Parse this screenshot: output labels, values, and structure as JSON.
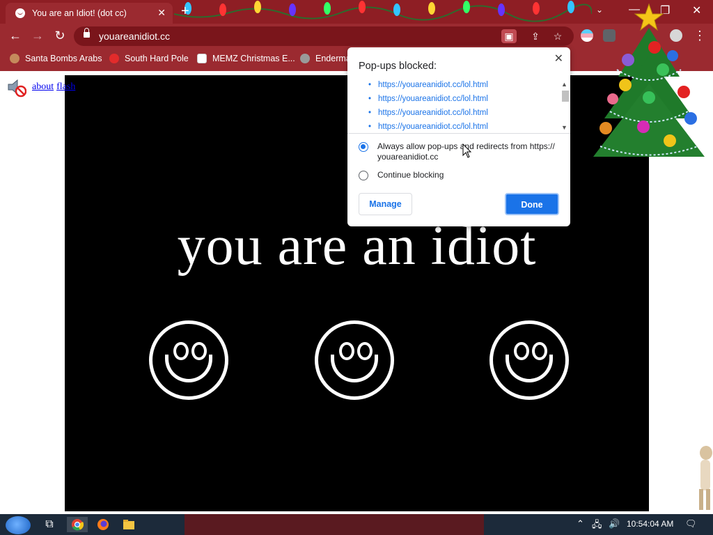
{
  "tab": {
    "title": "You are an Idiot! (dot cc)"
  },
  "address_bar": {
    "url": "youareanidiot.cc"
  },
  "bookmarks": [
    {
      "label": "Santa Bombs Arabs"
    },
    {
      "label": "South Hard Pole"
    },
    {
      "label": "MEMZ Christmas E..."
    },
    {
      "label": "Enderma"
    }
  ],
  "page": {
    "links": {
      "about": "about",
      "flash": "flash"
    },
    "headline": "you are an idiot"
  },
  "popup": {
    "title": "Pop-ups blocked:",
    "blocked_urls": [
      "https://youareanidiot.cc/lol.html",
      "https://youareanidiot.cc/lol.html",
      "https://youareanidiot.cc/lol.html",
      "https://youareanidiot.cc/lol.html"
    ],
    "option_allow": "Always allow pop-ups and redirects from https:// youareanidiot.cc",
    "option_block": "Continue blocking",
    "selected_option": "allow",
    "manage_label": "Manage",
    "done_label": "Done"
  },
  "taskbar": {
    "clock": "10:54:04 AM"
  },
  "colors": {
    "chrome_red": "#9b2a30",
    "accent_blue": "#1a73e8",
    "stage_black": "#000000"
  }
}
